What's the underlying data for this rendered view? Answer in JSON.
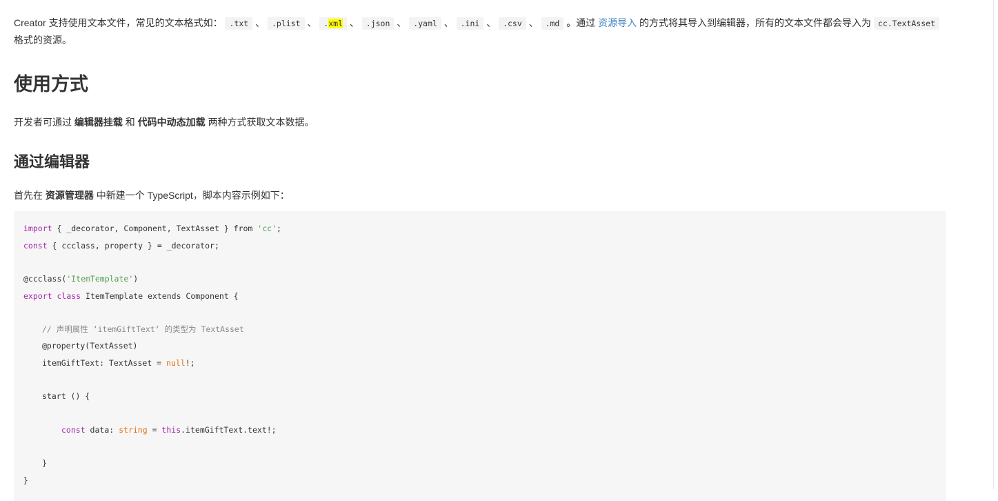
{
  "intro": {
    "t1": "Creator 支持使用文本文件，常见的文本格式如：",
    "formats": [
      ".txt",
      ".plist",
      ".xml",
      ".json",
      ".yaml",
      ".ini",
      ".csv",
      ".md"
    ],
    "sep": "、",
    "t_dot_cn": "。通过",
    "link": "资源导入",
    "t2": "的方式将其导入到编辑器，所有的文本文件都会导入为",
    "asset_type": "cc.TextAsset",
    "t3": "格式的资源。"
  },
  "heading1": "使用方式",
  "p2": {
    "t1": "开发者可通过",
    "b1": "编辑器挂载",
    "t2": "和",
    "b2": "代码中动态加载",
    "t3": "两种方式获取文本数据。"
  },
  "heading2": "通过编辑器",
  "p3": {
    "t1": "首先在",
    "b1": "资源管理器",
    "t2": "中新建一个 TypeScript，脚本内容示例如下："
  },
  "code": {
    "l1_kw": "import",
    "l1_mid": " { _decorator, Component, TextAsset } from ",
    "l1_str": "'cc'",
    "l1_end": ";",
    "l2_kw": "const",
    "l2_rest": " { ccclass, property } = _decorator;",
    "l3_a": "@ccclass(",
    "l3_str": "'ItemTemplate'",
    "l3_b": ")",
    "l4_kw1": "export",
    "l4_kw2": "class",
    "l4_rest": " ItemTemplate extends Component {",
    "l5_comment": "// 声明属性 ‘itemGiftText‘ 的类型为 TextAsset",
    "l6": "@property(TextAsset)",
    "l7_a": "itemGiftText: TextAsset = ",
    "l7_null": "null",
    "l7_b": "!;",
    "l8": "start () {",
    "l9_kw": "const",
    "l9_a": " data: ",
    "l9_type": "string",
    "l9_b": " = ",
    "l9_this": "this",
    "l9_c": ".itemGiftText.text!;",
    "l10": "}",
    "l11": "}"
  }
}
